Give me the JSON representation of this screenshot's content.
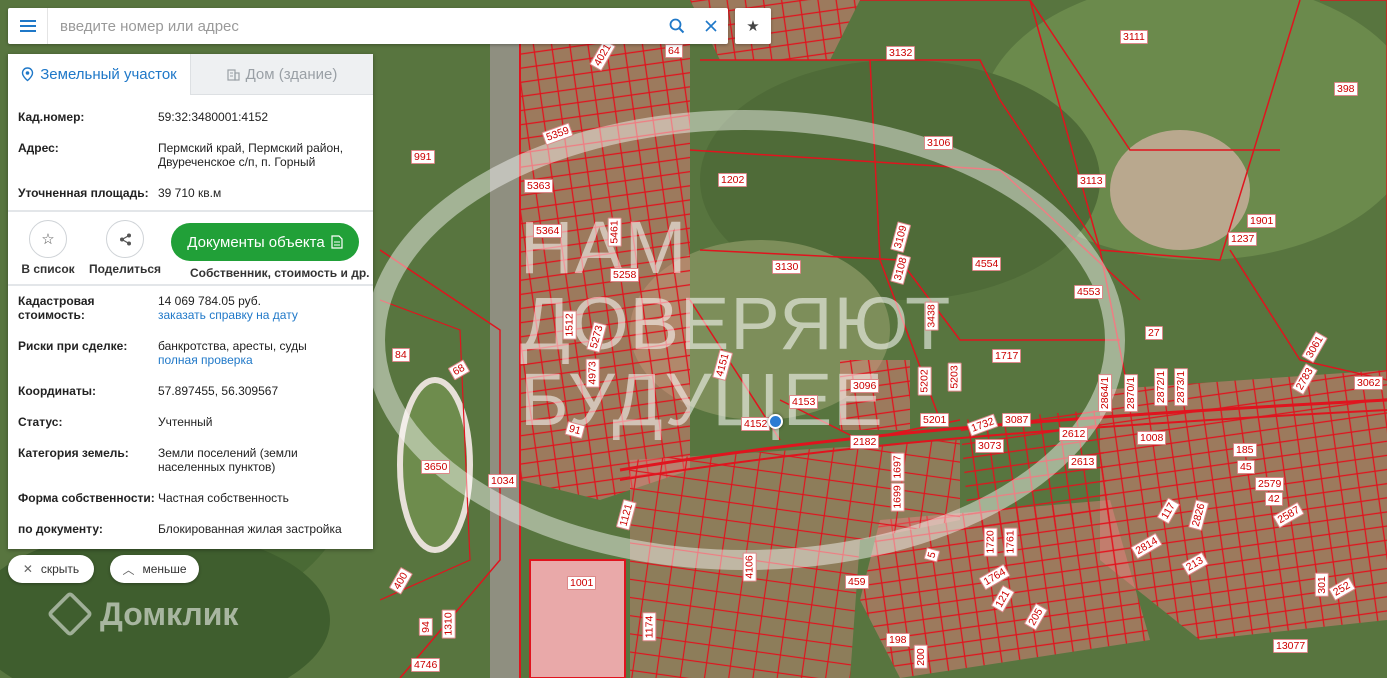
{
  "search": {
    "placeholder": "введите номер или адрес",
    "icons": {
      "menu": "menu-icon",
      "search": "search-icon",
      "clear": "close-icon",
      "favorite": "star-icon"
    }
  },
  "tabs": [
    {
      "label": "Земельный участок",
      "icon": "land-plot-icon",
      "active": true
    },
    {
      "label": "Дом (здание)",
      "icon": "building-icon",
      "active": false
    }
  ],
  "info": {
    "cad_number_label": "Кад.номер:",
    "cad_number": "59:32:3480001:4152",
    "address_label": "Адрес:",
    "address": "Пермский край, Пермский район, Двуреченское с/п, п. Горный",
    "area_label": "Уточненная площадь:",
    "area": "39 710 кв.м"
  },
  "actions": {
    "add_to_list": "В список",
    "share": "Поделиться",
    "documents": "Документы объекта",
    "documents_sub": "Собственник, стоимость и др."
  },
  "details": {
    "cad_value_label": "Кадастровая стоимость:",
    "cad_value": "14 069 784.05 руб.",
    "cad_value_link": "заказать справку на дату",
    "risks_label": "Риски при сделке:",
    "risks": "банкротства, аресты, суды",
    "risks_link": "полная проверка",
    "coords_label": "Координаты:",
    "coords": "57.897455, 56.309567",
    "status_label": "Статус:",
    "status": "Учтенный",
    "category_label": "Категория земель:",
    "category": "Земли поселений (земли населенных пунктов)",
    "ownership_label": "Форма собственности:",
    "ownership": "Частная собственность",
    "by_doc_label": "по документу:",
    "by_doc": "Блокированная жилая застройка"
  },
  "bottom": {
    "hide": "скрыть",
    "less": "меньше"
  },
  "watermark": {
    "lines": [
      "НАМ",
      "ДОВЕРЯЮТ",
      "БУДУЩЕЕ"
    ],
    "logo": "Домклик"
  },
  "map_labels": [
    "3111",
    "3132",
    "398",
    "991",
    "1202",
    "3106",
    "3113",
    "1901",
    "1237",
    "5363",
    "5364",
    "5461",
    "5258",
    "3130",
    "3109",
    "4554",
    "4553",
    "27",
    "3061",
    "2783",
    "3062",
    "84",
    "68",
    "1512",
    "5273",
    "4973",
    "4151",
    "3438",
    "5202",
    "5203",
    "1717",
    "2864/1",
    "2870/1",
    "2872/1",
    "2873/1",
    "4153",
    "3096",
    "4152",
    "91",
    "3650",
    "2182",
    "1732",
    "3087",
    "5201",
    "2612",
    "1008",
    "185",
    "45",
    "2579",
    "42",
    "2587",
    "3073",
    "2613",
    "1034",
    "1121",
    "1697",
    "1699",
    "117",
    "2826",
    "1720",
    "1761",
    "2814",
    "213",
    "4106",
    "5",
    "1764",
    "459",
    "1001",
    "400",
    "121",
    "94",
    "1310",
    "1174",
    "205",
    "198",
    "200",
    "4746",
    "301",
    "252",
    "13077",
    "5359",
    "4021",
    "64",
    "3108"
  ],
  "colors": {
    "accent": "#1f78c8",
    "primary_button": "#21a038",
    "parcel_line": "#e0141e",
    "parcel_fill": "#f08080"
  }
}
